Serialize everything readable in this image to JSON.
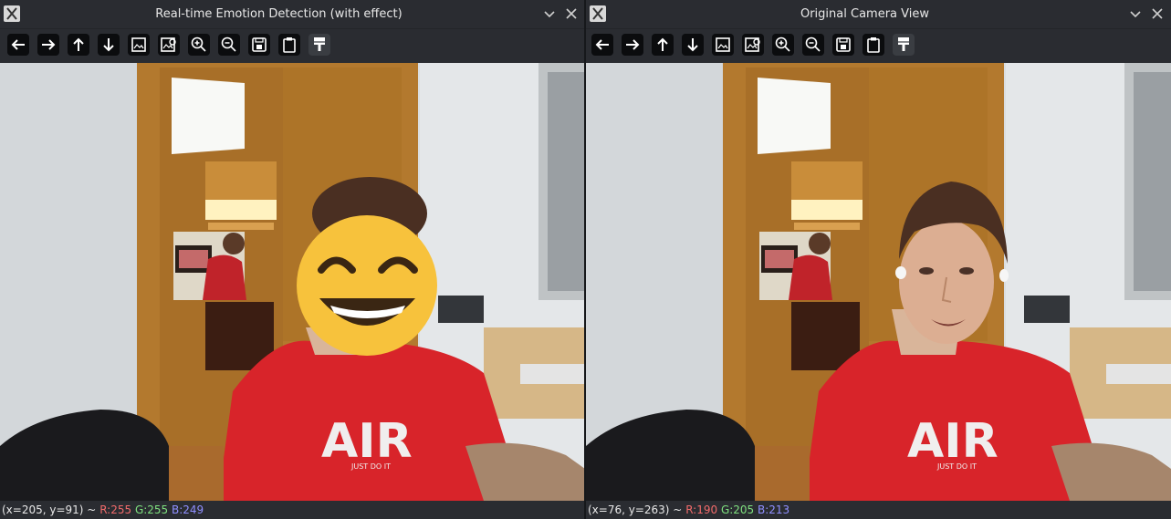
{
  "windows": [
    {
      "title": "Real-time Emotion Detection (with effect)",
      "status": {
        "coords": "(x=205, y=91) ~",
        "r": "R:255",
        "g": "G:255",
        "b": "B:249"
      }
    },
    {
      "title": "Original Camera View",
      "status": {
        "coords": "(x=76, y=263) ~",
        "r": "R:190",
        "g": "G:205",
        "b": "B:213"
      }
    }
  ],
  "toolbar_icons": [
    "arrow-left-icon",
    "arrow-right-icon",
    "arrow-up-icon",
    "arrow-down-icon",
    "image-icon",
    "image-save-icon",
    "zoom-in-icon",
    "zoom-out-icon",
    "save-icon",
    "clipboard-icon",
    "paint-brush-icon"
  ],
  "shirt_text": {
    "big": "AIR",
    "small": "JUST DO IT"
  },
  "colors": {
    "shirt": "#d8242a",
    "wall": "#dfe3e6",
    "door": "#b0782c",
    "emoji": "#f7c23c",
    "titlebar": "#2a2c31"
  }
}
